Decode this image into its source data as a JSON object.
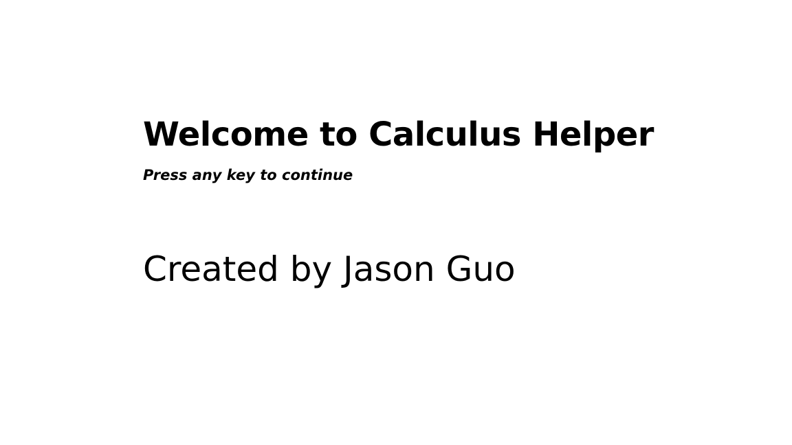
{
  "welcome": {
    "title": "Welcome to Calculus Helper",
    "prompt": "Press any key to continue",
    "credit": "Created by Jason Guo"
  }
}
